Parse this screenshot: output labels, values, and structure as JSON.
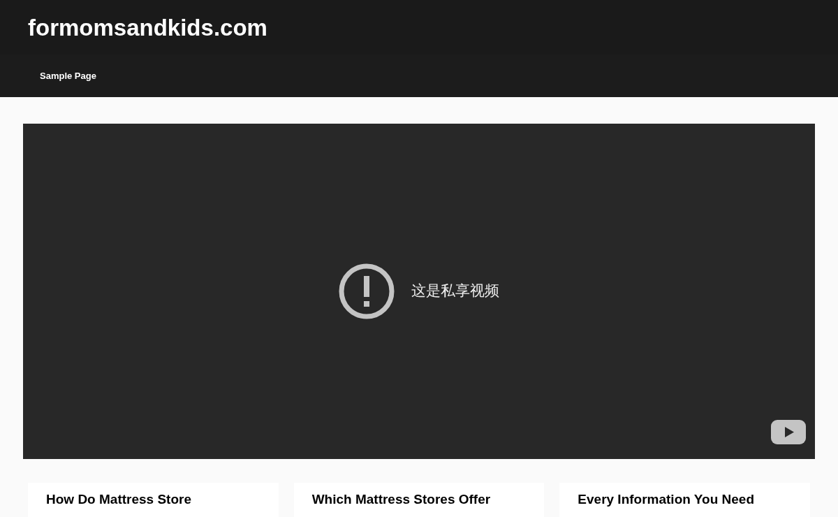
{
  "site_title": "formomsandkids.com",
  "nav": [
    {
      "label": "Sample Page"
    }
  ],
  "video": {
    "message": "这是私享视频"
  },
  "cards": [
    {
      "title": "How Do Mattress Store"
    },
    {
      "title": "Which Mattress Stores Offer"
    },
    {
      "title": "Every Information You Need"
    }
  ]
}
